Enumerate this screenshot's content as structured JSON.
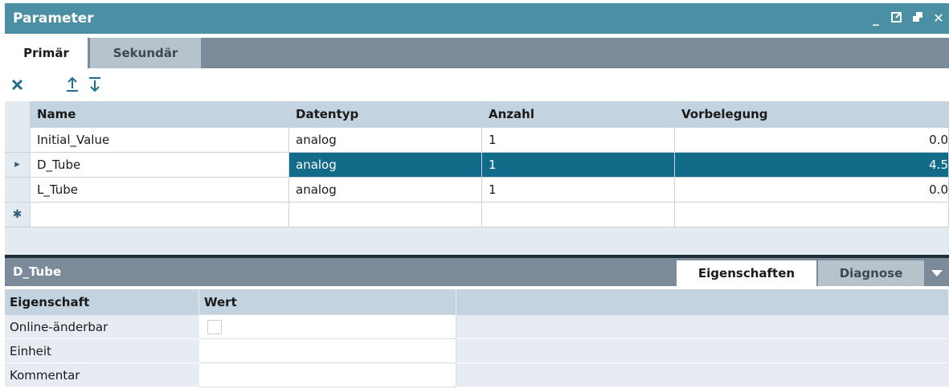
{
  "window": {
    "title": "Parameter",
    "buttons": {
      "minimize": "_",
      "undock": "⧉",
      "restore": "▪",
      "close": "✕"
    }
  },
  "tabs": [
    {
      "label": "Primär",
      "active": true
    },
    {
      "label": "Sekundär",
      "active": false
    }
  ],
  "toolbar": {
    "delete_icon": "close-icon",
    "move_up_icon": "arrow-up-icon",
    "move_down_icon": "arrow-down-icon",
    "delete_glyph": "✕",
    "up_glyph": "⤒",
    "down_glyph": "⤓"
  },
  "grid": {
    "columns": [
      "Name",
      "Datentyp",
      "Anzahl",
      "Vorbelegung"
    ],
    "rows": [
      {
        "marker": "",
        "name": "Initial_Value",
        "datentyp": "analog",
        "anzahl": "1",
        "vorbelegung": "0.0"
      },
      {
        "marker": "▸",
        "name": "D_Tube",
        "datentyp": "analog",
        "anzahl": "1",
        "vorbelegung": "4.5",
        "selected": true
      },
      {
        "marker": "",
        "name": "L_Tube",
        "datentyp": "analog",
        "anzahl": "1",
        "vorbelegung": "0.0"
      },
      {
        "marker": "✱",
        "name": "",
        "datentyp": "",
        "anzahl": "",
        "vorbelegung": ""
      }
    ]
  },
  "details": {
    "title": "D_Tube",
    "tabs": [
      {
        "label": "Eigenschaften",
        "active": true
      },
      {
        "label": "Diagnose",
        "active": false
      }
    ],
    "dropdown_glyph": "▼",
    "columns": [
      "Eigenschaft",
      "Wert"
    ],
    "properties": [
      {
        "name": "Online-änderbar",
        "value_type": "checkbox",
        "checked": false
      },
      {
        "name": "Einheit",
        "value": ""
      },
      {
        "name": "Kommentar",
        "value": ""
      }
    ]
  },
  "colors": {
    "title_bar": "#4a8fa3",
    "tab_bar": "#7b8b9a",
    "selection": "#136b8a",
    "header": "#c3d3df",
    "accent_icon": "#2d5f7a"
  }
}
